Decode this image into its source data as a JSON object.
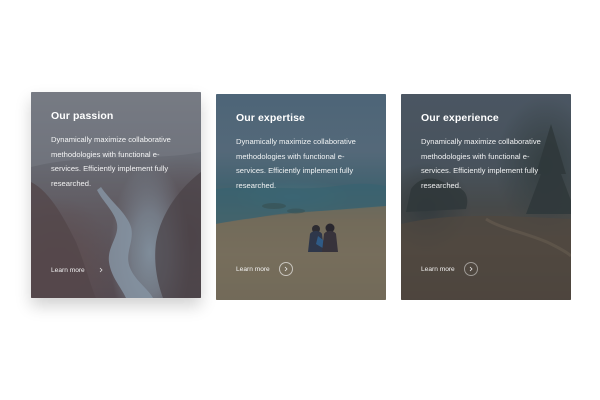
{
  "cards": [
    {
      "title": "Our passion",
      "text": "Dynamically maximize collaborative methodologies with functional e-services. Efficiently implement fully researched.",
      "link_label": "Learn more",
      "icon": "chevron-right-icon"
    },
    {
      "title": "Our expertise",
      "text": "Dynamically maximize collaborative methodologies with functional e-services. Efficiently implement fully researched.",
      "link_label": "Learn more",
      "icon": "chevron-right-icon"
    },
    {
      "title": "Our experience",
      "text": "Dynamically maximize collaborative methodologies with functional e-services. Efficiently implement fully researched.",
      "link_label": "Learn more",
      "icon": "chevron-right-icon"
    }
  ]
}
